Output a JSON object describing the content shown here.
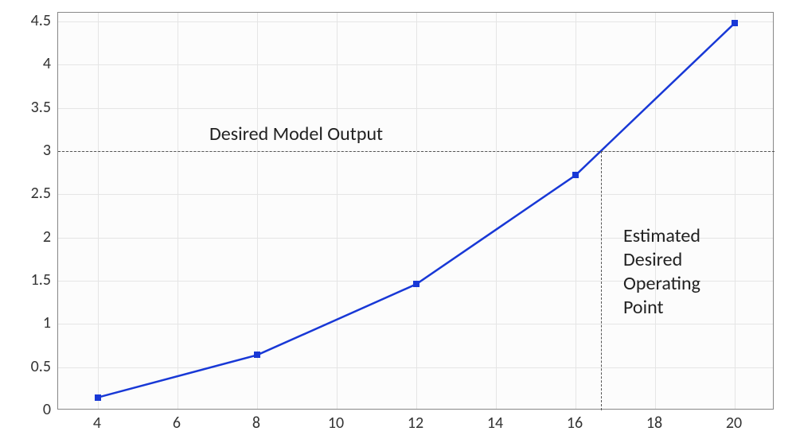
{
  "chart_data": {
    "type": "line",
    "x": [
      4,
      8,
      12,
      16,
      20
    ],
    "values": [
      0.15,
      0.64,
      1.46,
      2.72,
      4.48
    ],
    "title": "",
    "xlabel": "",
    "ylabel": "",
    "xlim": [
      3,
      21
    ],
    "ylim": [
      0,
      4.6
    ],
    "x_ticks": [
      4,
      6,
      8,
      10,
      12,
      14,
      16,
      18,
      20
    ],
    "y_ticks": [
      0,
      0.5,
      1,
      1.5,
      2,
      2.5,
      3,
      3.5,
      4,
      4.5
    ]
  },
  "annotations": {
    "desired_output": "Desired Model Output",
    "estimated_point_l1": "Estimated",
    "estimated_point_l2": "Desired",
    "estimated_point_l3": "Operating",
    "estimated_point_l4": "Point"
  },
  "reference": {
    "y_value": 3.0,
    "x_intersect": 16.64
  },
  "colors": {
    "series": "#1838d6",
    "grid": "#e5e5e5",
    "dash": "#555555"
  }
}
